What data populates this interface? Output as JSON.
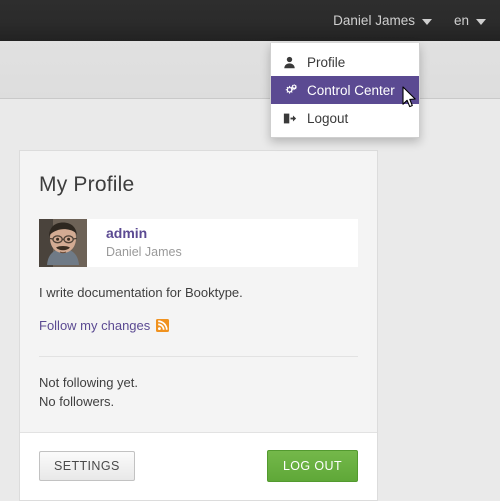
{
  "topbar": {
    "user_menu_label": "Daniel James",
    "language_label": "en",
    "caret_icon": "chevron-down-icon"
  },
  "dropdown": {
    "items": [
      {
        "label": "Profile",
        "icon": "user-icon",
        "active": false
      },
      {
        "label": "Control Center",
        "icon": "gears-icon",
        "active": true
      },
      {
        "label": "Logout",
        "icon": "logout-icon",
        "active": false
      }
    ],
    "highlight_color": "#5b4a92"
  },
  "card": {
    "title": "My Profile",
    "user": {
      "login": "admin",
      "fullname": "Daniel James",
      "avatar_icon": "user-photo-avatar"
    },
    "bio": "I write documentation for Booktype.",
    "follow_link": "Follow my changes",
    "rss_icon": "rss-icon",
    "stats": {
      "following": "Not following yet.",
      "followers": "No followers."
    },
    "footer": {
      "settings_label": "SETTINGS",
      "logout_label": "LOG OUT"
    }
  },
  "colors": {
    "accent_purple": "#5b4a92",
    "logout_green": "#5fa838",
    "rss_orange": "#f0921f",
    "topbar_dark": "#2b2b2b",
    "page_background": "#eaeaea"
  },
  "cursor": {
    "icon": "arrow-cursor"
  }
}
